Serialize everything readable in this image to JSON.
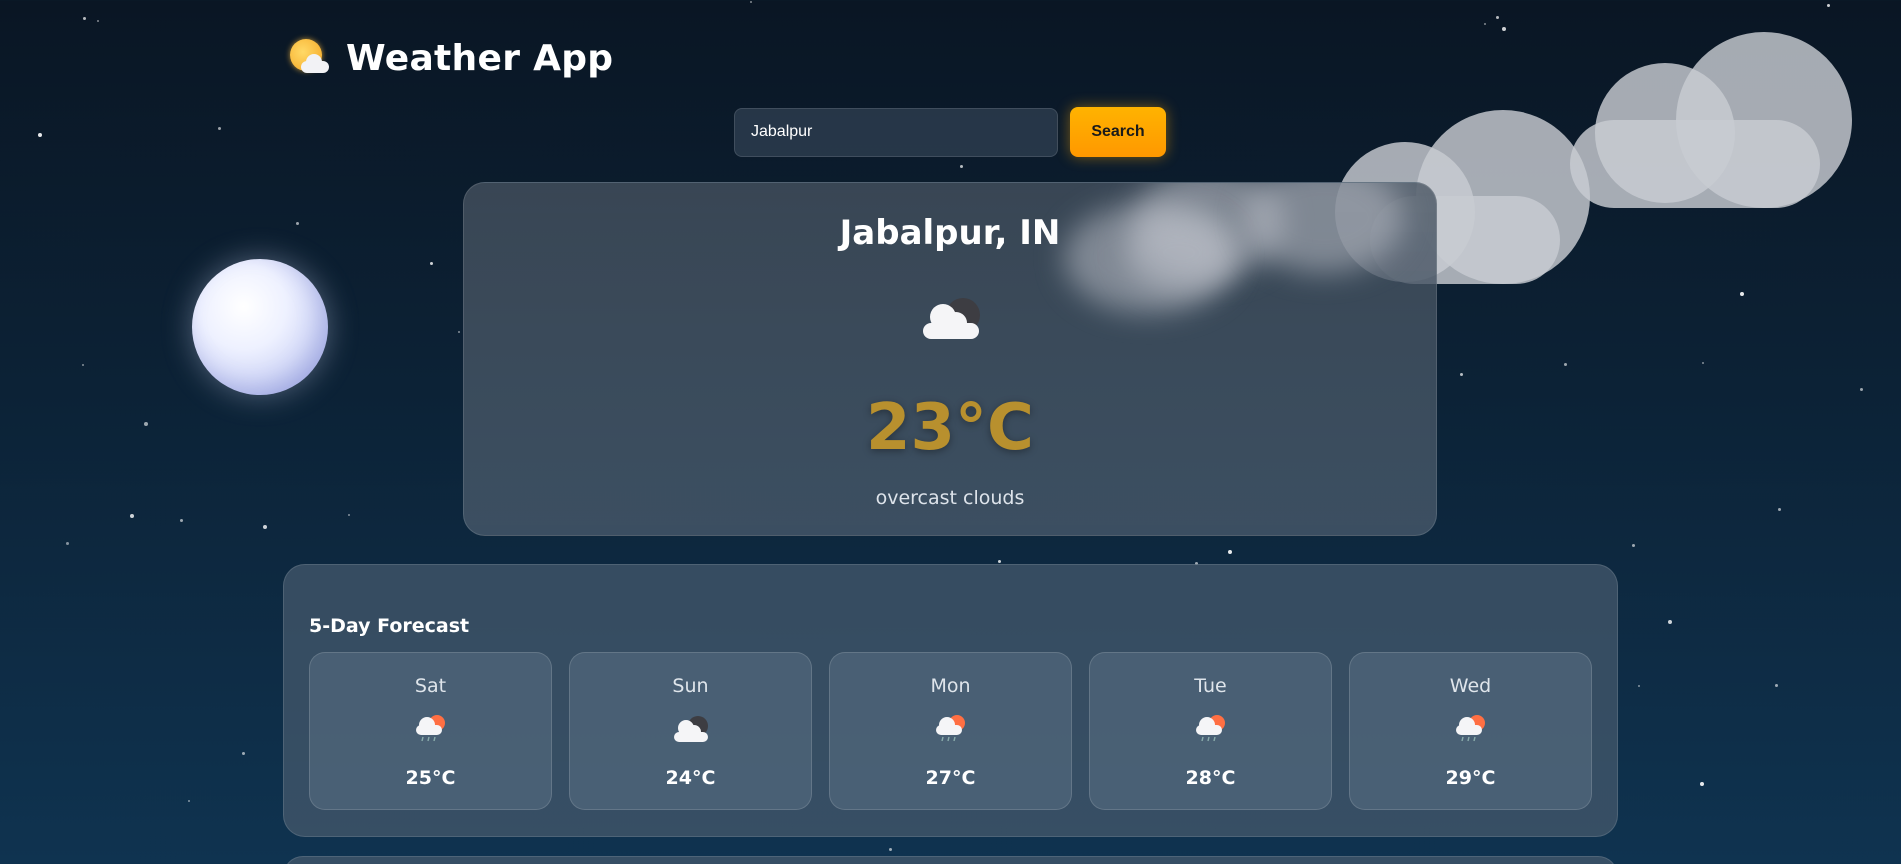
{
  "header": {
    "title": "Weather App",
    "icon": "sun-behind-cloud-icon"
  },
  "search": {
    "value": "Jabalpur",
    "placeholder": "",
    "button_label": "Search"
  },
  "current": {
    "city": "Jabalpur, IN",
    "icon": "overcast-clouds-icon",
    "temperature": "23°C",
    "description": "overcast clouds"
  },
  "forecast": {
    "title": "5-Day Forecast",
    "days": [
      {
        "day": "Sat",
        "icon": "rain-cloud-sun-icon",
        "temp": "25°C"
      },
      {
        "day": "Sun",
        "icon": "overcast-clouds-icon",
        "temp": "24°C"
      },
      {
        "day": "Mon",
        "icon": "rain-cloud-sun-icon",
        "temp": "27°C"
      },
      {
        "day": "Tue",
        "icon": "rain-cloud-sun-icon",
        "temp": "28°C"
      },
      {
        "day": "Wed",
        "icon": "rain-cloud-sun-icon",
        "temp": "29°C"
      }
    ]
  },
  "colors": {
    "accent": "#ff9800",
    "temperature": "#b8902e",
    "background_top": "#0a1624",
    "background_bottom": "#0f3350"
  }
}
